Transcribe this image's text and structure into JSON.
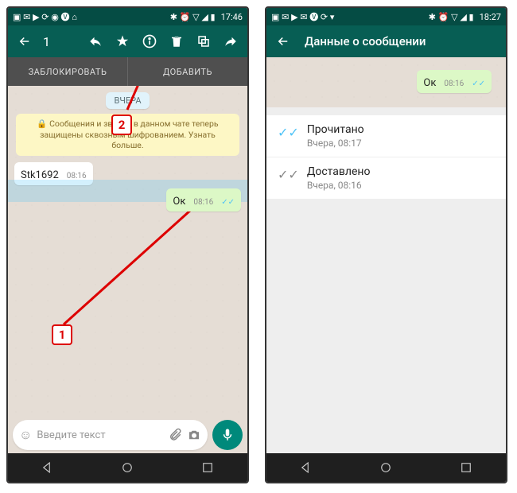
{
  "left": {
    "status": {
      "time": "17:46"
    },
    "toolbar": {
      "selected_count": "1"
    },
    "tabs": {
      "block": "ЗАБЛОКИРОВАТЬ",
      "add": "ДОБАВИТЬ"
    },
    "day_label": "ВЧЕРА",
    "encryption_notice": "🔒 Сообщения и звонки в данном чате теперь защищены сквозным шифрованием. Узнать больше.",
    "incoming": {
      "text": "Stk1692",
      "time": "08:16"
    },
    "outgoing": {
      "text": "Ок",
      "time": "08:16"
    },
    "input_placeholder": "Введите текст",
    "callouts": {
      "one": "1",
      "two": "2"
    }
  },
  "right": {
    "status": {
      "time": "18:27"
    },
    "title": "Данные о сообщении",
    "preview": {
      "text": "Ок",
      "time": "08:16"
    },
    "read": {
      "label": "Прочитано",
      "sub": "Вчера, 08:17"
    },
    "delivered": {
      "label": "Доставлено",
      "sub": "Вчера, 08:16"
    }
  }
}
